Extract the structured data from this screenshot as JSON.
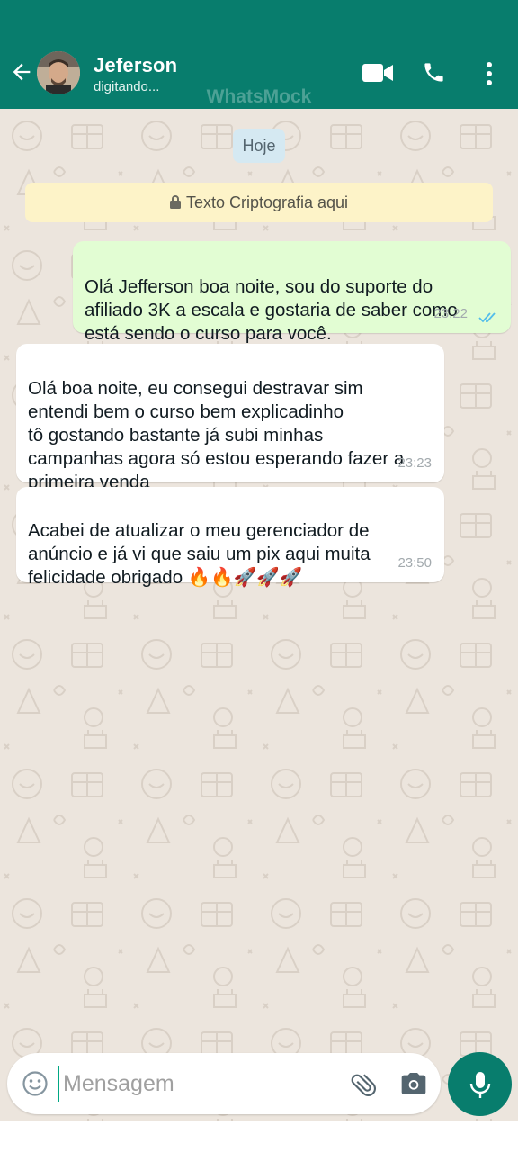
{
  "header": {
    "contact_name": "Jeferson",
    "status": "digitando...",
    "watermark": "WhatsMock",
    "icons": [
      "back-arrow-icon",
      "video-call-icon",
      "phone-icon",
      "more-vert-icon"
    ]
  },
  "chat": {
    "date_chip": "Hoje",
    "encryption_notice": "Texto Criptografia aqui",
    "messages": [
      {
        "direction": "outgoing",
        "text": "Olá Jefferson boa noite, sou do suporte do\nafiliado 3K a escala e gostaria de saber como\nestá sendo o curso para você.",
        "time": "23:22",
        "read": true
      },
      {
        "direction": "incoming",
        "text": "Olá boa noite, eu consegui destravar sim\nentendi bem o curso bem explicadinho\ntô gostando bastante já subi minhas\ncampanhas agora só estou esperando fazer a\nprimeira venda",
        "time": "23:23"
      },
      {
        "direction": "incoming",
        "text": "Acabei de atualizar o meu gerenciador de\nanúncio e já vi que saiu um pix aqui muita\nfelicidade obrigado 🔥🔥🚀🚀🚀",
        "time": "23:50"
      }
    ]
  },
  "composer": {
    "placeholder": "Mensagem",
    "icons": [
      "emoji-icon",
      "attach-icon",
      "camera-icon",
      "mic-icon"
    ]
  },
  "colors": {
    "header": "#087d6d",
    "outgoing_bubble": "#e2fdd3",
    "incoming_bubble": "#ffffff",
    "chat_bg": "#ece5dd",
    "encryption_bg": "#fdf3c8",
    "date_chip_bg": "#d5e9f2",
    "read_ticks": "#53bdeb"
  }
}
